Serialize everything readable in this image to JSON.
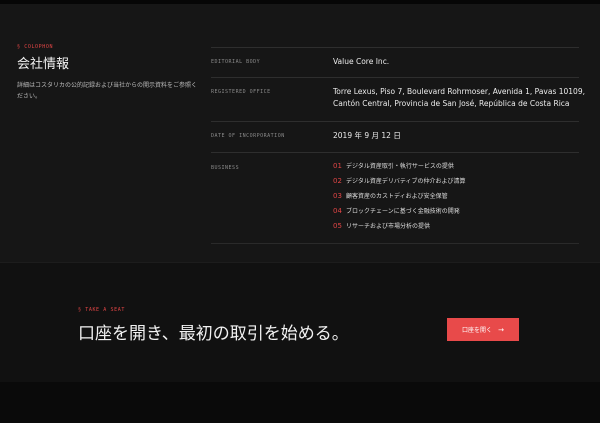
{
  "colophon": {
    "eyebrow": "§ COLOPHON",
    "title": "会社情報",
    "description": "詳細はコスタリカの公的記録および当社からの開示資料をご参照ください。"
  },
  "details": {
    "editorial_body": {
      "label": "EDITORIAL BODY",
      "value": "Value Core Inc."
    },
    "registered_office": {
      "label": "REGISTERED OFFICE",
      "line1": "Torre Lexus, Piso 7, Boulevard Rohrmoser, Avenida 1, Pavas 10109,",
      "line2": "Cantón Central, Provincia de San José, República de Costa Rica"
    },
    "incorporation": {
      "label": "DATE OF INCORPORATION",
      "value": "2019 年 9 月 12 日"
    },
    "business": {
      "label": "BUSINESS",
      "items": [
        {
          "num": "01",
          "text": "デジタル資産取引・執行サービスの提供"
        },
        {
          "num": "02",
          "text": "デジタル資産デリバティブの仲介および清算"
        },
        {
          "num": "03",
          "text": "顧客資産のカストディおよび安全保管"
        },
        {
          "num": "04",
          "text": "ブロックチェーンに基づく金融技術の開発"
        },
        {
          "num": "05",
          "text": "リサーチおよび市場分析の提供"
        }
      ]
    }
  },
  "cta": {
    "eyebrow": "§ TAKE A SEAT",
    "headline": "口座を開き、最初の取引を始める。",
    "button_label": "口座を開く",
    "button_arrow": "→"
  },
  "colors": {
    "accent": "#e84a4a",
    "background": "#161616"
  }
}
